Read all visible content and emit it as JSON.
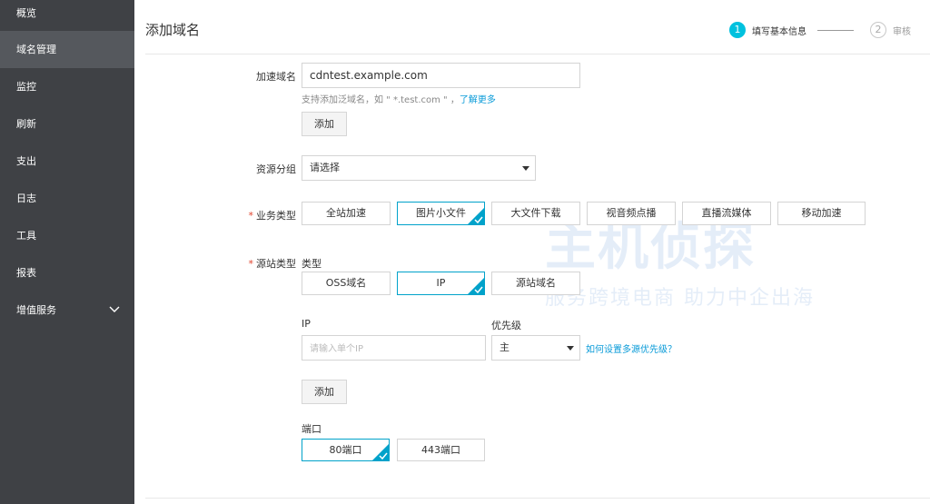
{
  "sidebar": {
    "items": [
      {
        "label": "概览"
      },
      {
        "label": "域名管理"
      },
      {
        "label": "监控"
      },
      {
        "label": "刷新"
      },
      {
        "label": "支出"
      },
      {
        "label": "日志"
      },
      {
        "label": "工具"
      },
      {
        "label": "报表"
      },
      {
        "label": "增值服务"
      }
    ]
  },
  "header": {
    "title": "添加域名",
    "steps": [
      {
        "num": "1",
        "label": "填写基本信息"
      },
      {
        "num": "2",
        "label": "审核"
      }
    ]
  },
  "form": {
    "domain": {
      "label": "加速域名",
      "value": "cdntest.example.com",
      "hint": "支持添加泛域名，如 \" *.test.com \" ，",
      "hint_link": "了解更多",
      "add_label": "添加"
    },
    "group": {
      "label": "资源分组",
      "value": "请选择"
    },
    "business": {
      "label": "业务类型",
      "options": [
        "全站加速",
        "图片小文件",
        "大文件下载",
        "视音频点播",
        "直播流媒体",
        "移动加速"
      ],
      "selected": "图片小文件"
    },
    "origin": {
      "label": "源站类型",
      "type_label": "类型",
      "types": [
        "OSS域名",
        "IP",
        "源站域名"
      ],
      "selected": "IP",
      "ip_label": "IP",
      "ip_placeholder": "请输入单个IP",
      "priority_label": "优先级",
      "priority_value": "主",
      "priority_link": "如何设置多源优先级？",
      "add_label": "添加",
      "port_label": "端口",
      "ports": [
        "80端口",
        "443端口"
      ],
      "port_selected": "80端口"
    }
  },
  "watermark": {
    "big": "主机侦探",
    "small": "服务跨境电商 助力中企出海"
  },
  "colors": {
    "sidebar_bg": "#3f4145",
    "sidebar_active": "#55585d",
    "accent": "#00c1de",
    "link": "#0a9bd8",
    "required": "#e0422c"
  }
}
